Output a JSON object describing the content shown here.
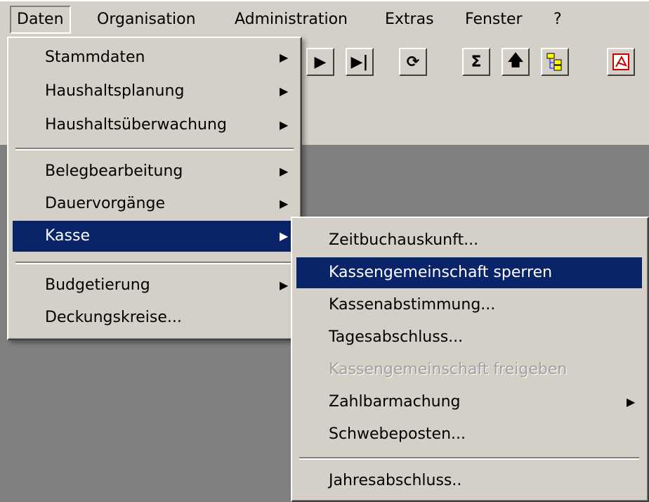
{
  "menubar": {
    "items": [
      "Daten",
      "Organisation",
      "Administration",
      "Extras",
      "Fenster",
      "?"
    ]
  },
  "toolbar": {
    "icons": [
      "play-next-icon",
      "skip-last-icon",
      "refresh-icon",
      "sum-icon",
      "up-arrow-icon",
      "tree-icon",
      "pdf-icon"
    ]
  },
  "daten_menu": {
    "items": [
      {
        "label": "Stammdaten",
        "submenu": true
      },
      {
        "label": "Haushaltsplanung",
        "submenu": true
      },
      {
        "label": "Haushaltsüberwachung",
        "submenu": true
      },
      {
        "label": "Belegbearbeitung",
        "submenu": true
      },
      {
        "label": "Dauervorgänge",
        "submenu": true
      },
      {
        "label": "Kasse",
        "submenu": true,
        "highlighted": true
      },
      {
        "label": "Budgetierung",
        "submenu": true
      },
      {
        "label": "Deckungskreise...",
        "submenu": false
      }
    ]
  },
  "kasse_menu": {
    "items": [
      {
        "label": "Zeitbuchauskunft..."
      },
      {
        "label": "Kassengemeinschaft sperren",
        "highlighted": true
      },
      {
        "label": "Kassenabstimmung..."
      },
      {
        "label": "Tagesabschluss..."
      },
      {
        "label": "Kassengemeinschaft freigeben",
        "disabled": true
      },
      {
        "label": "Zahlbarmachung",
        "submenu": true
      },
      {
        "label": "Schwebeposten..."
      },
      {
        "label": "Jahresabschluss.."
      }
    ]
  },
  "colors": {
    "face": "#d4d0c8",
    "highlight": "#0a246a",
    "workspace": "#808080",
    "disabled": "#a0a0a0"
  }
}
